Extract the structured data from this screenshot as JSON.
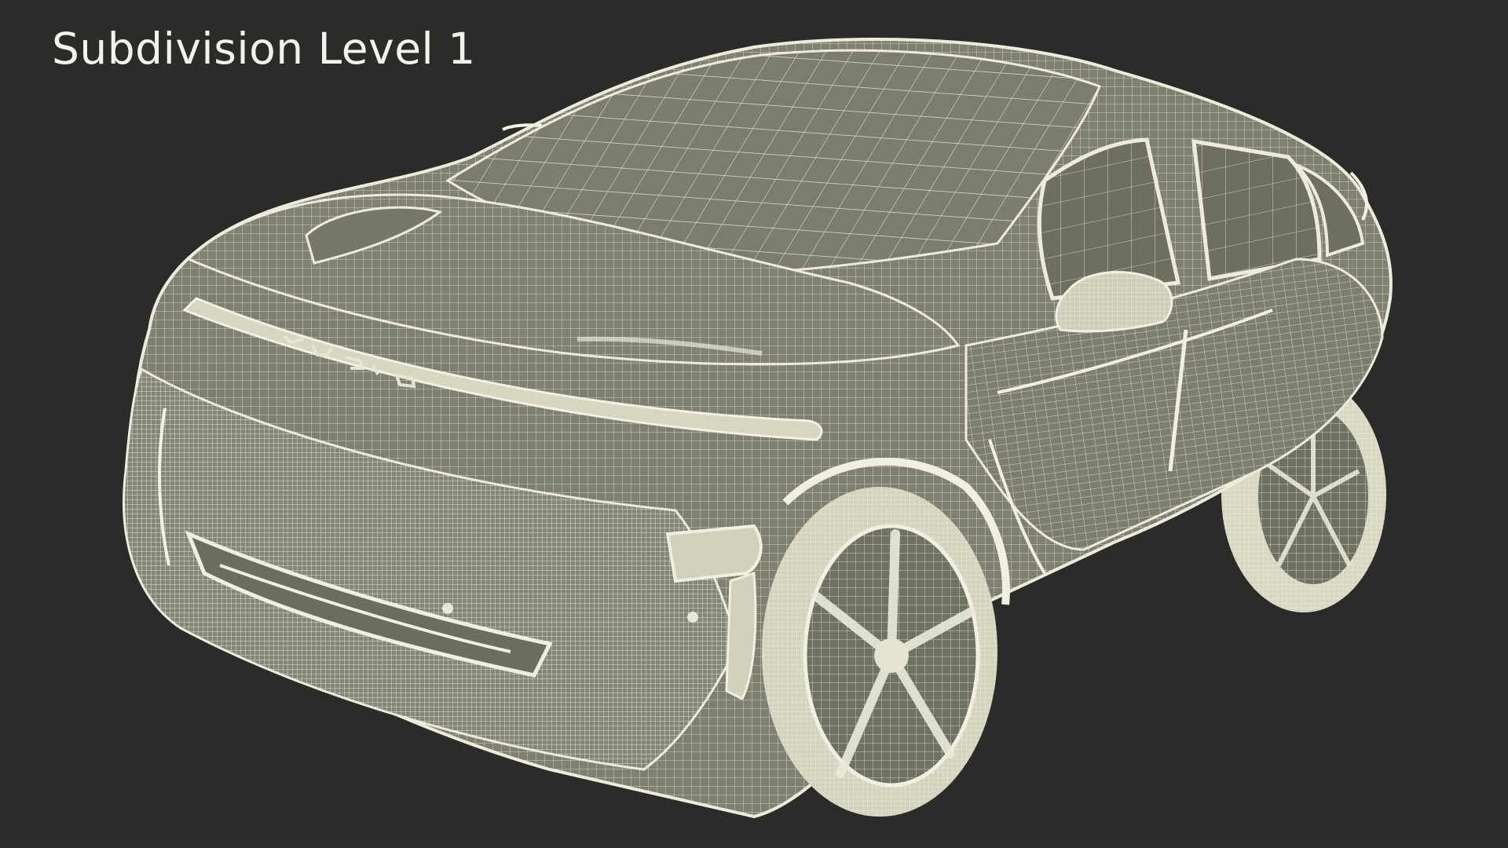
{
  "overlay": {
    "title": "Subdivision Level 1"
  },
  "render": {
    "subject": "car wireframe",
    "background_color": "#2b2b2a",
    "wire_color": "#e9e8d6",
    "surface_color": "#7f8072"
  }
}
